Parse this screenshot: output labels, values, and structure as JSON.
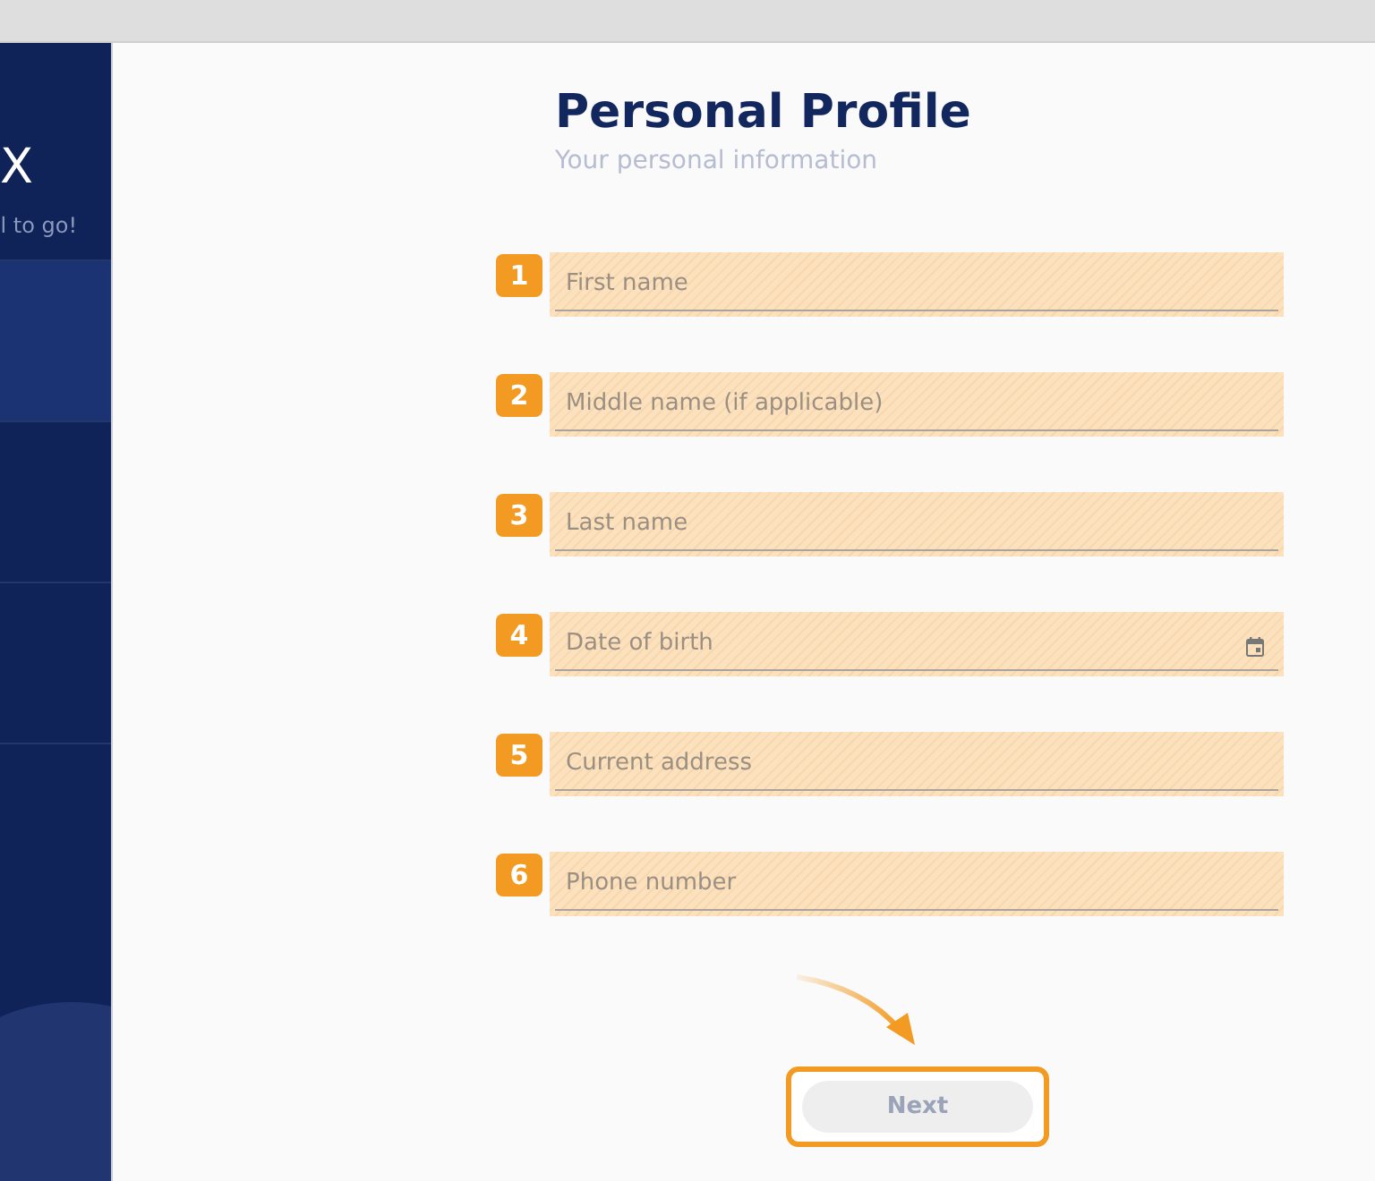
{
  "sidebar": {
    "title": "X",
    "subtitle": "l to go!",
    "steps": [
      {
        "selected": true
      },
      {
        "selected": false
      },
      {
        "selected": false
      }
    ]
  },
  "header": {
    "title": "Personal Profile",
    "subtitle": "Your personal information"
  },
  "fields": [
    {
      "number": "1",
      "placeholder": "First name",
      "kind": "text"
    },
    {
      "number": "2",
      "placeholder": "Middle name (if applicable)",
      "kind": "text"
    },
    {
      "number": "3",
      "placeholder": "Last name",
      "kind": "text"
    },
    {
      "number": "4",
      "placeholder": "Date of birth",
      "kind": "date"
    },
    {
      "number": "5",
      "placeholder": "Current address",
      "kind": "text"
    },
    {
      "number": "6",
      "placeholder": "Phone number",
      "kind": "text"
    }
  ],
  "next_button": {
    "label": "Next",
    "highlighted": true
  }
}
